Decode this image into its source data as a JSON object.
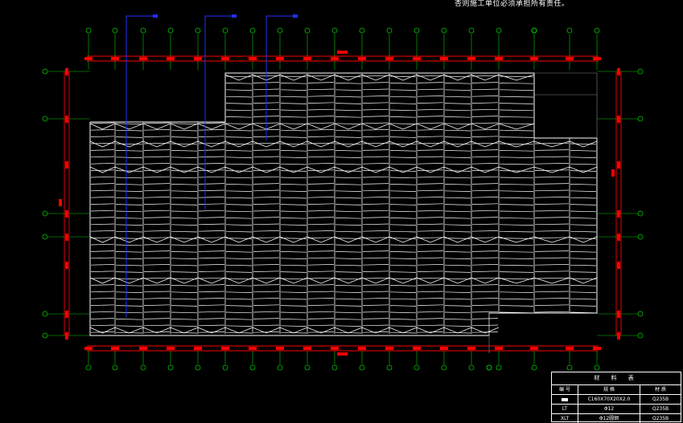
{
  "note": "杏则施工单位必须承担所有责任。",
  "material_table": {
    "title": "材 料 表",
    "headers": [
      "编 号",
      "规 格",
      "材 质"
    ],
    "rows": [
      {
        "code": "",
        "spec": "C160X70X20X2.0",
        "material": "Q235B"
      },
      {
        "code": "LT",
        "spec": "Φ12",
        "material": "Q235B"
      },
      {
        "code": "XLT",
        "spec": "Φ12圆钢",
        "material": "Q235B"
      }
    ]
  },
  "colors": {
    "grid_green": "#00c800",
    "dim_red": "#ff0000",
    "purlin_white": "#ffffff",
    "leader_blue": "#2030ff"
  },
  "icons": [
    "axis-bubble",
    "dimension-tick",
    "leader-line"
  ]
}
